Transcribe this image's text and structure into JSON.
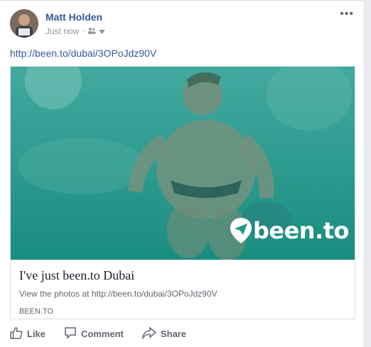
{
  "post": {
    "author": "Matt Holden",
    "timestamp": "Just now",
    "privacy_icon": "friends-icon",
    "link_text": "http://been.to/dubai/3OPoJdz90V"
  },
  "card": {
    "brand": "been.to",
    "title": "I've just been.to Dubai",
    "description": "View the photos at http://been.to/dubai/3OPoJdz90V",
    "domain": "BEEN.TO"
  },
  "actions": {
    "like": "Like",
    "comment": "Comment",
    "share": "Share"
  },
  "colors": {
    "link": "#365899",
    "overlay": "#1e9a8c",
    "meta": "#90949c"
  }
}
